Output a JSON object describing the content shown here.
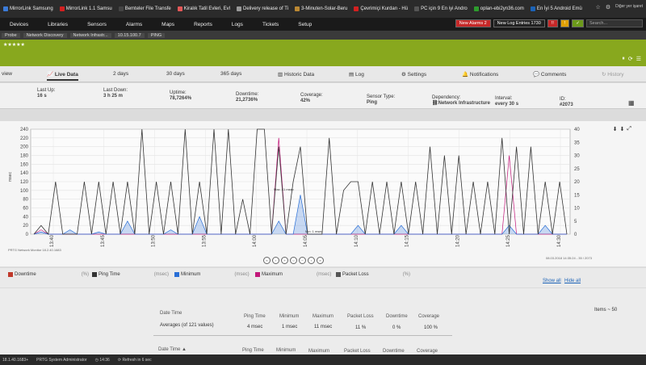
{
  "bookmarks": [
    "MirrorLink Samsung",
    "MirrorLink 1.1 Samsu",
    "Bemteler File Transfe",
    "Kiralık Tatil Evleri, Evl",
    "Delivery release of Ti",
    "3-Minuten-Solar-Beru",
    "Çevrimiçi Kurdan - Hü",
    "PC için 9 En iyi Andro",
    "oplan-ebi2yn36.com",
    "En İyi 5 Android Emü"
  ],
  "bookmark_colors": [
    "#3b7bd8",
    "#d32020",
    "#444444",
    "#e45858",
    "#999999",
    "#bb8833",
    "#d32020",
    "#555555",
    "#2d9c2d",
    "#1c63b7"
  ],
  "other_favorites": "Diğer yer işaret",
  "nav": {
    "items": [
      "Devices",
      "Libraries",
      "Sensors",
      "Alarms",
      "Maps",
      "Reports",
      "Logs",
      "Tickets",
      "Setup"
    ],
    "new_alarms": "New Alarms 2",
    "new_log_entries": "New Log Entries 1730",
    "search_placeholder": "Search..."
  },
  "crumbs": [
    "Probe",
    "Network Discovery",
    "Network Infrastr...",
    "10.15.100.7",
    "PING"
  ],
  "rating": "★★★★★",
  "tabs": [
    "Live Data",
    "2 days",
    "30 days",
    "365 days",
    "Historic Data",
    "Log",
    "Settings",
    "Notifications",
    "Comments",
    "History"
  ],
  "overview_label": "view",
  "info": [
    {
      "label": "Last Up:",
      "value": "16 s"
    },
    {
      "label": "Last Down:",
      "value": "3 h 25 m"
    },
    {
      "label": "Uptime:",
      "value": "78,7264%"
    },
    {
      "label": "Downtime:",
      "value": "21,2736%"
    },
    {
      "label": "Coverage:",
      "value": "42%"
    },
    {
      "label": "Sensor Type:",
      "value": "Ping"
    },
    {
      "label": "Dependency:",
      "value": "Network Infrastructure"
    },
    {
      "label": "Interval:",
      "value": "every 30 s"
    },
    {
      "label": "ID:",
      "value": "#2073"
    }
  ],
  "chart_data": {
    "type": "line",
    "x": [
      "13:40",
      "13:45",
      "13:50",
      "13:55",
      "14:00",
      "14:05",
      "14:10",
      "14:15",
      "14:20",
      "14:25",
      "14:30"
    ],
    "yticks_left": [
      0,
      20,
      40,
      60,
      80,
      100,
      120,
      140,
      160,
      180,
      200,
      220,
      240
    ],
    "yticks_right": [
      0,
      5,
      10,
      15,
      20,
      25,
      30,
      35,
      40
    ],
    "ylabel_left": "msec",
    "ylim": [
      0,
      240
    ],
    "annotations": [
      "Max: 41 msec",
      "Min: 1 msec"
    ],
    "footer_left": "PRTG Network Monitor 18.2.40.1683",
    "footer_right": "08.03.2018 14:35:24 - 35 / 2073",
    "series": [
      {
        "name": "Ping Time",
        "color": "#333333",
        "values": [
          0,
          20,
          0,
          120,
          0,
          0,
          0,
          120,
          0,
          120,
          0,
          120,
          0,
          120,
          0,
          240,
          0,
          120,
          0,
          120,
          0,
          240,
          0,
          120,
          0,
          240,
          0,
          240,
          0,
          80,
          0,
          240,
          240,
          0,
          200,
          0,
          120,
          200,
          0,
          0,
          0,
          220,
          0,
          100,
          120,
          120,
          0,
          120,
          0,
          120,
          0,
          120,
          0,
          120,
          0,
          200,
          0,
          180,
          0,
          180,
          0,
          120,
          0,
          120,
          0,
          220,
          0,
          200,
          0,
          200,
          0,
          120,
          0,
          120,
          0
        ]
      },
      {
        "name": "Minimum",
        "color": "#2a6fd6",
        "values": [
          0,
          5,
          0,
          0,
          0,
          10,
          0,
          0,
          0,
          5,
          0,
          0,
          0,
          30,
          0,
          0,
          0,
          0,
          0,
          10,
          0,
          0,
          0,
          40,
          0,
          0,
          0,
          0,
          0,
          0,
          0,
          0,
          0,
          0,
          30,
          0,
          0,
          90,
          0,
          0,
          0,
          0,
          0,
          0,
          0,
          20,
          0,
          0,
          0,
          0,
          0,
          20,
          0,
          0,
          0,
          0,
          0,
          0,
          0,
          0,
          0,
          0,
          0,
          0,
          0,
          0,
          20,
          0,
          0,
          0,
          0,
          20,
          0,
          0,
          0
        ]
      },
      {
        "name": "Maximum",
        "color": "#c2187a",
        "values": [
          0,
          10,
          0,
          0,
          0,
          0,
          0,
          0,
          0,
          0,
          0,
          0,
          0,
          0,
          0,
          0,
          0,
          0,
          0,
          0,
          0,
          0,
          0,
          0,
          0,
          0,
          0,
          0,
          0,
          0,
          0,
          0,
          0,
          0,
          220,
          0,
          0,
          0,
          0,
          0,
          0,
          0,
          0,
          0,
          0,
          0,
          0,
          0,
          0,
          0,
          0,
          0,
          0,
          0,
          0,
          0,
          0,
          0,
          0,
          0,
          0,
          0,
          0,
          0,
          0,
          0,
          180,
          0,
          0,
          0,
          0,
          0,
          0,
          0,
          0
        ]
      }
    ]
  },
  "legend": [
    {
      "name": "Downtime",
      "unit": "(%)",
      "color": "#c0392b"
    },
    {
      "name": "Ping Time",
      "unit": "(msec)",
      "color": "#333333"
    },
    {
      "name": "Minimum",
      "unit": "(msec)",
      "color": "#2a6fd6"
    },
    {
      "name": "Maximum",
      "unit": "(msec)",
      "color": "#c2187a"
    },
    {
      "name": "Packet Loss",
      "unit": "(%)",
      "color": "#555555"
    }
  ],
  "show_all": "Show all",
  "hide_all": "Hide all",
  "items_label": "Items ~ 50",
  "table": {
    "headers": [
      "Date Time",
      "Ping Time",
      "Minimum",
      "Maximum",
      "Packet Loss",
      "Downtime",
      "Coverage"
    ],
    "averages": [
      "Averages (of 121 values)",
      "4 msec",
      "1 msec",
      "11 msec",
      "11 %",
      "0 %",
      "100 %"
    ],
    "sort_header": "Date Time ▲"
  },
  "status": [
    "18.1.40.1683+",
    "PRTG System Administrator",
    "14:36",
    "Refresh in 6 sec"
  ]
}
